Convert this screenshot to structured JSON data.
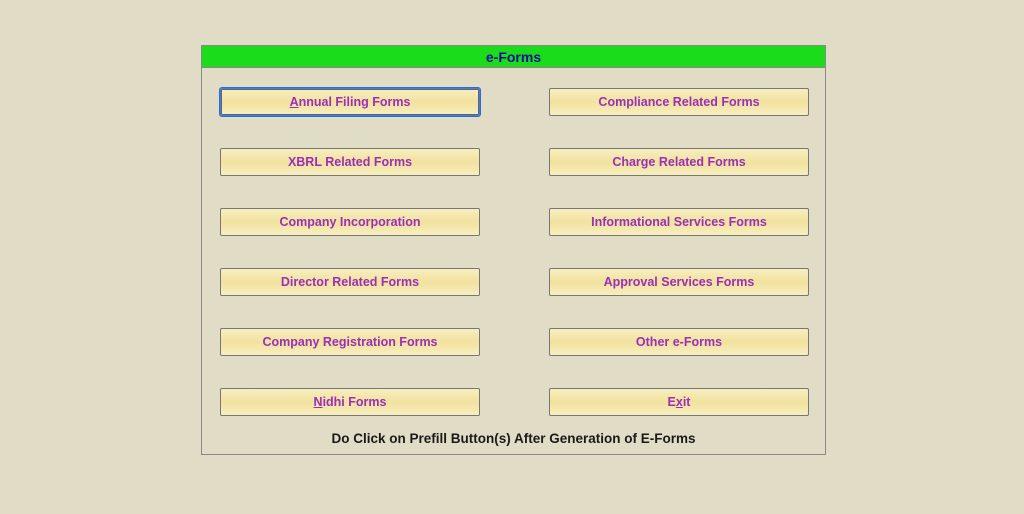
{
  "panel": {
    "title": "e-Forms"
  },
  "buttons": {
    "annual_filing": "Annual Filing Forms",
    "compliance": "Compliance Related Forms",
    "xbrl": "XBRL Related Forms",
    "charge": "Charge Related Forms",
    "company_incorporation": "Company Incorporation",
    "informational": "Informational Services Forms",
    "director": "Director Related Forms",
    "approval": "Approval Services Forms",
    "company_registration": "Company Registration Forms",
    "other": "Other e-Forms",
    "nidhi": "Nidhi Forms",
    "exit": "Exit"
  },
  "mnemonics": {
    "annual_filing": "A",
    "nidhi": "N",
    "exit": "x"
  },
  "footer": "Do Click on Prefill Button(s) After Generation of E-Forms",
  "colors": {
    "page_bg": "#e1dcc5",
    "title_bg": "#1bdc1b",
    "title_fg": "#0a0aa0",
    "button_text": "#9a2fb8"
  }
}
